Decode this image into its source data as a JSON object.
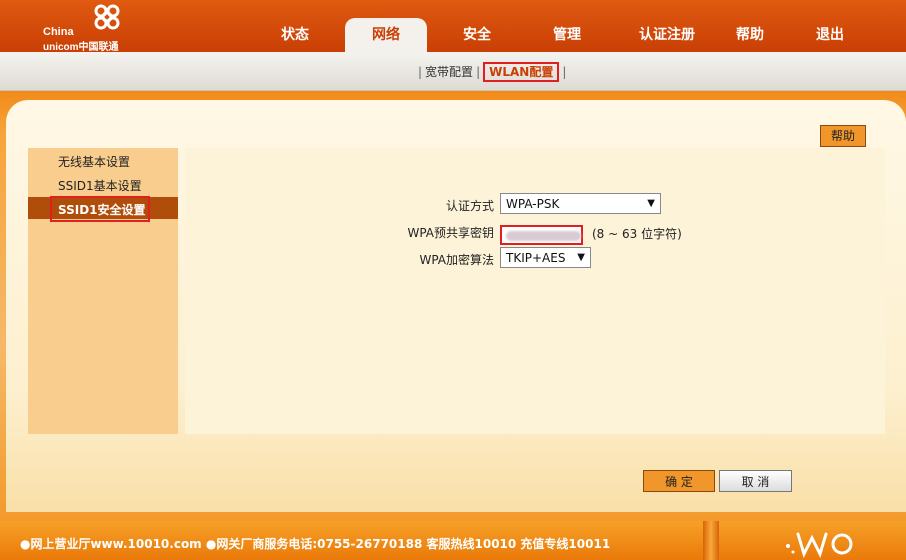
{
  "brand": {
    "line1": "China",
    "line2": "unicom中国联通"
  },
  "nav": {
    "items": [
      {
        "label": "状态"
      },
      {
        "label": "网络"
      },
      {
        "label": "安全"
      },
      {
        "label": "管理"
      },
      {
        "label": "认证注册"
      },
      {
        "label": "帮助"
      },
      {
        "label": "退出"
      }
    ],
    "active": "网络"
  },
  "subnav": {
    "items": [
      {
        "label": "宽带配置"
      },
      {
        "label": "WLAN配置"
      }
    ],
    "active": "WLAN配置"
  },
  "help_button": "帮助",
  "sidebar": {
    "items": [
      {
        "label": "无线基本设置"
      },
      {
        "label": "SSID1基本设置"
      },
      {
        "label": "SSID1安全设置"
      }
    ],
    "active": "SSID1安全设置"
  },
  "form": {
    "auth_label": "认证方式",
    "auth_value": "WPA-PSK",
    "key_label": "WPA预共享密钥",
    "key_hint": "(8 ~ 63 位字符)",
    "enc_label": "WPA加密算法",
    "enc_value": "TKIP+AES"
  },
  "buttons": {
    "ok": "确 定",
    "cancel": "取 消"
  },
  "footer": {
    "text": "●网上营业厅www.10010.com ●网关厂商服务电话:0755-26770188 客服热线10010 充值专线10011"
  },
  "colors": {
    "header": "#c93f05",
    "accent": "#f1962a",
    "highlight_border": "#e02020",
    "sidebar_active": "#b14d0b"
  }
}
